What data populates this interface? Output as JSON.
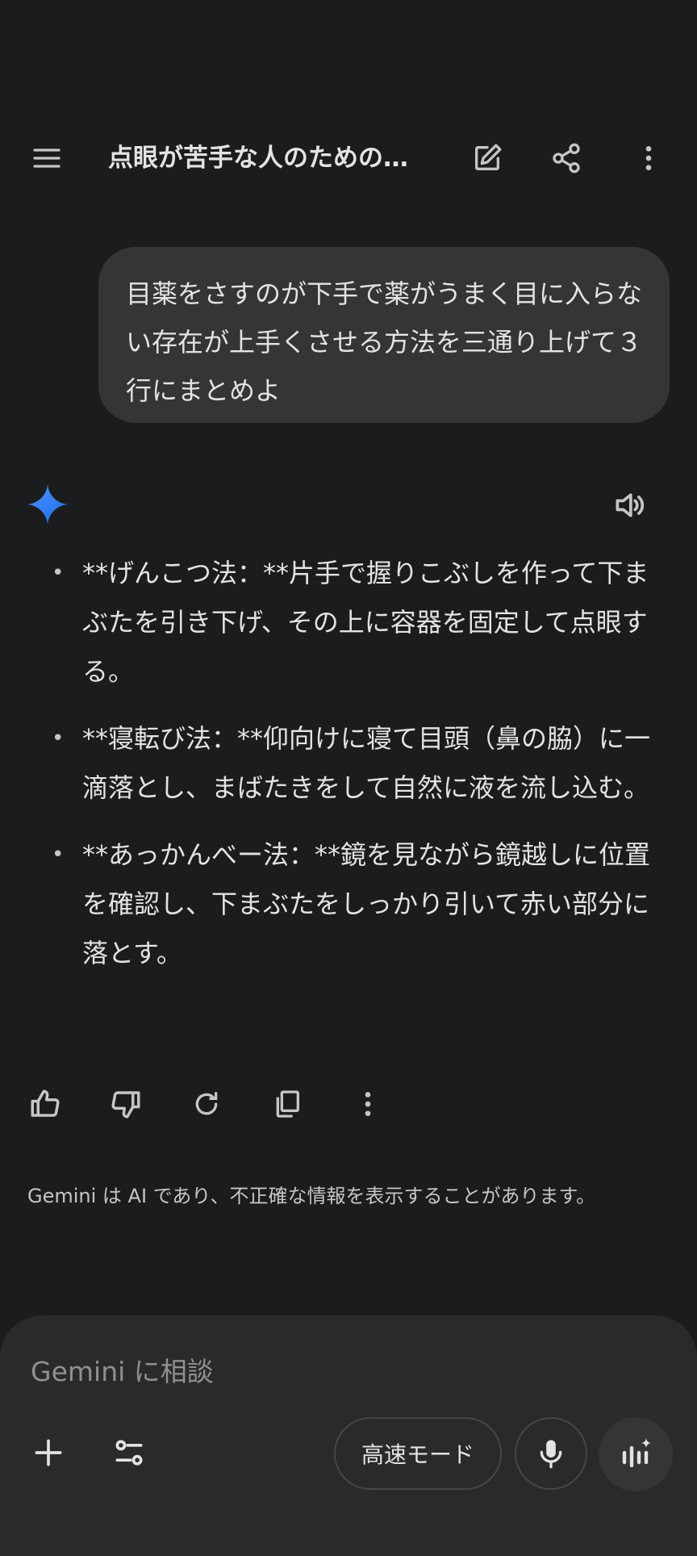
{
  "header": {
    "title": "点眼が苦手な人のための…",
    "menu_icon": "menu-icon",
    "edit_icon": "edit-icon",
    "share_icon": "share-icon",
    "more_icon": "more-vert-icon"
  },
  "user_message": {
    "text": "目薬をさすのが下手で薬がうまく目に入らない存在が上手くさせる方法を三通り上げて３行にまとめよ"
  },
  "response": {
    "logo_icon": "gemini-sparkle-icon",
    "speak_icon": "volume-icon",
    "bullet_char": "•",
    "items": [
      "**げんこつ法：**片手で握りこぶしを作って下まぶたを引き下げ、その上に容器を固定して点眼する。",
      "**寝転び法：**仰向けに寝て目頭（鼻の脇）に一滴落とし、まばたきをして自然に液を流し込む。",
      "**あっかんべー法：**鏡を見ながら鏡越しに位置を確認し、下まぶたをしっかり引いて赤い部分に落とす。"
    ]
  },
  "actions": {
    "icons": [
      "thumb-up-icon",
      "thumb-down-icon",
      "regenerate-icon",
      "copy-icon",
      "more-vert-icon"
    ]
  },
  "disclaimer": "Gemini は AI であり、不正確な情報を表示することがあります。",
  "composer": {
    "placeholder": "Gemini に相談",
    "mode_label": "高速モード",
    "icons": [
      "plus-icon",
      "tune-icon",
      "mic-icon",
      "live-icon"
    ]
  },
  "colors": {
    "background": "#1b1c1d",
    "bubble": "#333537",
    "composer": "#282a2c",
    "text": "#e3e3e3",
    "muted": "#c4c7c5",
    "gemini_blue": "#4285f4"
  }
}
